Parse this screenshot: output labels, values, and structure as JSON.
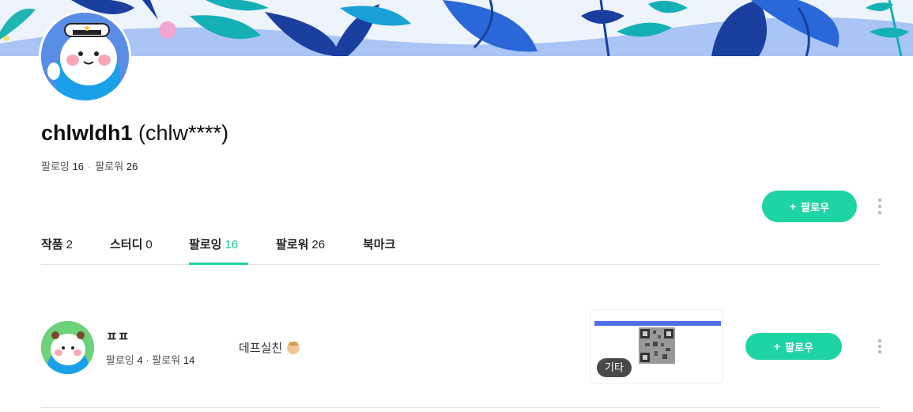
{
  "profile": {
    "nickname": "chlwldh1",
    "user_id": "(chlw****)",
    "following_label": "팔로잉",
    "following_count": "16",
    "followers_label": "팔로워",
    "followers_count": "26",
    "separator": "·"
  },
  "actions": {
    "follow_plus": "+",
    "follow_label": "팔로우"
  },
  "tabs": [
    {
      "label": "작품",
      "count": "2"
    },
    {
      "label": "스터디",
      "count": "0"
    },
    {
      "label": "팔로잉",
      "count": "16",
      "active": true
    },
    {
      "label": "팔로워",
      "count": "26"
    },
    {
      "label": "북마크",
      "count": ""
    }
  ],
  "following_list": [
    {
      "name": "ㅍㅍ",
      "following_label": "팔로잉",
      "following_count": "4",
      "separator": "·",
      "followers_label": "팔로워",
      "followers_count": "14",
      "bio": "데프실친",
      "thumbnail_badge": "기타",
      "follow_plus": "+",
      "follow_label": "팔로우"
    }
  ],
  "colors": {
    "accent": "#1fd4a4",
    "accent_text": "#1fc89a"
  }
}
